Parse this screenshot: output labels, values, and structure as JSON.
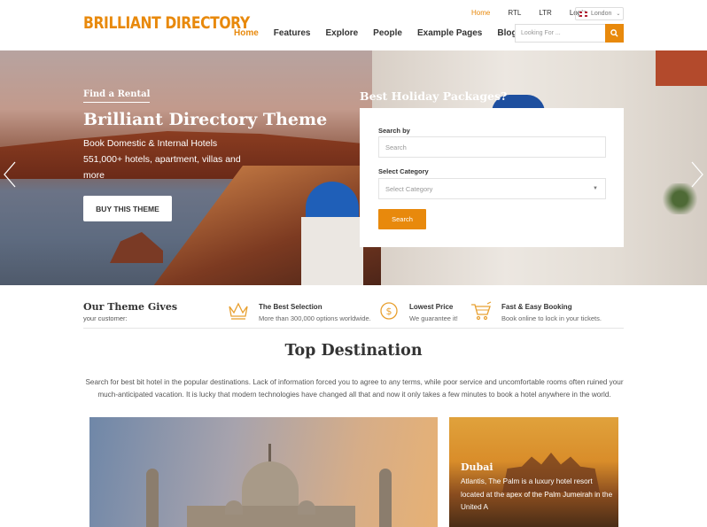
{
  "header": {
    "logo": "BRILLIANT DIRECTORY",
    "topbar": [
      {
        "label": "Home",
        "active": true
      },
      {
        "label": "RTL",
        "active": false
      },
      {
        "label": "LTR",
        "active": false
      },
      {
        "label": "Login",
        "active": false
      }
    ],
    "language": {
      "flag": "uk-flag-icon",
      "selected": "London"
    },
    "nav": [
      {
        "label": "Home",
        "active": true
      },
      {
        "label": "Features",
        "active": false
      },
      {
        "label": "Explore",
        "active": false
      },
      {
        "label": "People",
        "active": false
      },
      {
        "label": "Example Pages",
        "active": false
      },
      {
        "label": "Blog",
        "active": false
      }
    ],
    "search": {
      "placeholder": "Looking For ...",
      "icon": "search-icon"
    }
  },
  "hero": {
    "eyebrow": "Find a Rental",
    "title": "Brilliant Directory Theme",
    "subtitle": "Book Domestic & Internal Hotels 551,000+ hotels, apartment, villas and more",
    "cta": "BUY THIS THEME",
    "prev_icon": "chevron-left-icon",
    "next_icon": "chevron-right-icon"
  },
  "search_panel": {
    "title": "Best Holiday Packages?",
    "search_label": "Search by",
    "search_placeholder": "Search",
    "category_label": "Select Category",
    "category_selected": "Select Category",
    "button": "Search"
  },
  "features": {
    "heading": "Our Theme Gives",
    "sub": "your customer:",
    "items": [
      {
        "icon": "crown-icon",
        "title": "The Best Selection",
        "desc": "More than 300,000 options worldwide."
      },
      {
        "icon": "dollar-coin-icon",
        "title": "Lowest Price",
        "desc": "We guarantee it!"
      },
      {
        "icon": "shopping-cart-icon",
        "title": "Fast & Easy Booking",
        "desc": "Book online to lock in your tickets."
      }
    ]
  },
  "destinations": {
    "title": "Top Destination",
    "description": "Search for best bit hotel in the popular destinations. Lack of information forced you to agree to any terms, while poor service and uncomfortable rooms often ruined your much-anticipated vacation. It is lucky that modern technologies have changed all that and now it only takes a few minutes to book a hotel anywhere in the world.",
    "cards": [
      {
        "name": "",
        "image": "taj-mahal-image"
      },
      {
        "name": "Dubai",
        "desc": "Atlantis, The Palm is a luxury hotel resort located at the apex of the Palm Jumeirah in the United A",
        "image": "atlantis-palm-image"
      }
    ]
  },
  "colors": {
    "accent": "#e8890c",
    "text": "#333333",
    "muted": "#666666"
  }
}
